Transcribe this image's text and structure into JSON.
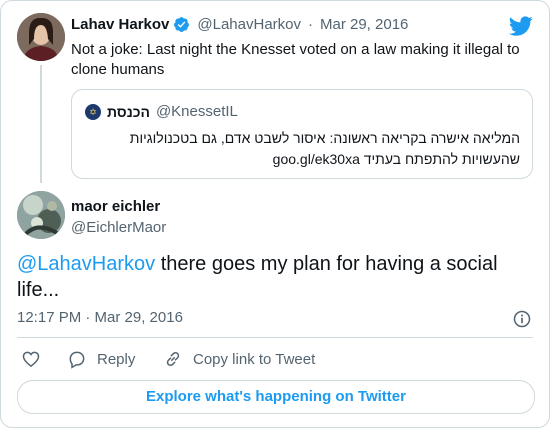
{
  "colors": {
    "accent": "#1d9bf0",
    "muted": "#536471",
    "border": "#cfd9de",
    "text": "#0f1419"
  },
  "original_tweet": {
    "author_name": "Lahav Harkov",
    "handle": "@LahavHarkov",
    "separator": "·",
    "date": "Mar 29, 2016",
    "verified_icon": "verified-badge-icon",
    "text": "Not a joke: Last night the Knesset voted on a law making it illegal to clone humans"
  },
  "quoted_tweet": {
    "author_name": "הכנסת",
    "handle": "@KnessetIL",
    "text": "המליאה אישרה בקריאה ראשונה: איסור לשבט אדם, גם בטכנולוגיות שהעשויות להתפתח בעתיד goo.gl/ek30xa"
  },
  "reply_tweet": {
    "author_name": "maor eichler",
    "handle": "@EichlerMaor",
    "mention": "@LahavHarkov",
    "text": " there goes my plan for having a social life...",
    "timestamp": "12:17 PM · Mar 29, 2016"
  },
  "actions": {
    "like_icon": "heart-icon",
    "reply_label": "Reply",
    "reply_icon": "speech-bubble-icon",
    "copy_label": "Copy link to Tweet",
    "copy_icon": "link-icon"
  },
  "explore_label": "Explore what's happening on Twitter",
  "brand_icon": "twitter-bird-icon"
}
